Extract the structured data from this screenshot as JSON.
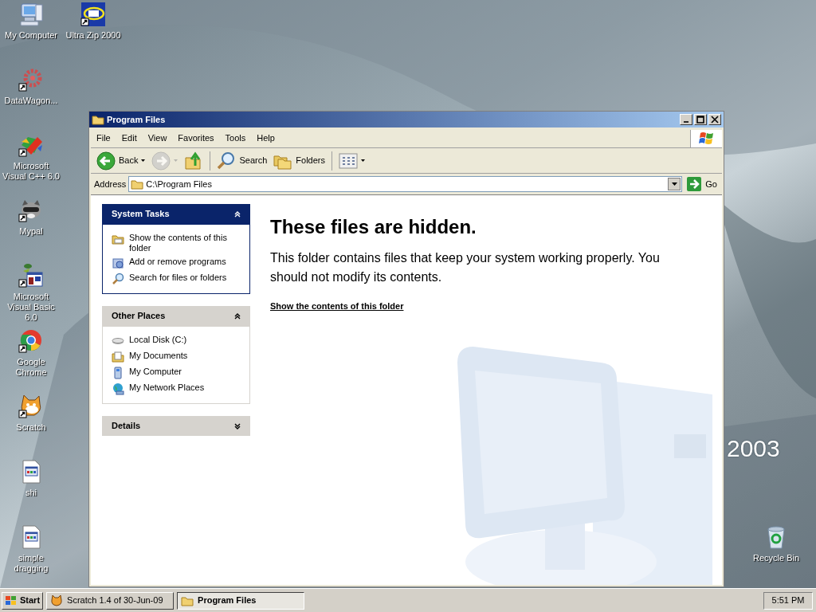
{
  "desktop": {
    "wallpaper_text": "2003",
    "icons": [
      {
        "label": "My Computer",
        "kind": "computer",
        "shortcut": false
      },
      {
        "label": "Ultra Zip 2000",
        "kind": "zip",
        "shortcut": true
      },
      {
        "label": "DataWagon...",
        "kind": "gear",
        "shortcut": true
      },
      {
        "label": "Microsoft Visual C++ 6.0",
        "kind": "cpp",
        "shortcut": true
      },
      {
        "label": "Mypal",
        "kind": "raccoon",
        "shortcut": true
      },
      {
        "label": "Microsoft Visual Basic 6.0",
        "kind": "vb",
        "shortcut": true
      },
      {
        "label": "Google Chrome",
        "kind": "chrome",
        "shortcut": true
      },
      {
        "label": "Scratch",
        "kind": "cat",
        "shortcut": true
      },
      {
        "label": "shi",
        "kind": "file",
        "shortcut": false
      },
      {
        "label": "simple dragging",
        "kind": "file",
        "shortcut": false
      },
      {
        "label": "Recycle Bin",
        "kind": "bin",
        "shortcut": false
      }
    ]
  },
  "window": {
    "title": "Program Files",
    "menu": [
      "File",
      "Edit",
      "View",
      "Favorites",
      "Tools",
      "Help"
    ],
    "toolbar": [
      {
        "kind": "back",
        "label": "Back",
        "disabled": false
      },
      {
        "kind": "forward",
        "disabled": true
      },
      {
        "kind": "up",
        "disabled": false
      },
      {
        "kind": "search",
        "label": "Search",
        "disabled": false
      },
      {
        "kind": "folders",
        "label": "Folders",
        "disabled": false
      },
      {
        "kind": "views",
        "disabled": false
      }
    ],
    "address": {
      "label": "Address",
      "value": "C:\\Program Files",
      "go": "Go"
    },
    "panels": [
      {
        "title": "System Tasks",
        "kind": "special",
        "expanded": true,
        "items": [
          {
            "label": "Show the contents of this folder",
            "kind": "folderview"
          },
          {
            "label": "Add or remove programs",
            "kind": "addremove"
          },
          {
            "label": "Search for files or folders",
            "kind": "search"
          }
        ]
      },
      {
        "title": "Other Places",
        "kind": "normal",
        "expanded": true,
        "items": [
          {
            "label": "Local Disk (C:)",
            "kind": "disk"
          },
          {
            "label": "My Documents",
            "kind": "documents"
          },
          {
            "label": "My Computer",
            "kind": "computer"
          },
          {
            "label": "My Network Places",
            "kind": "network"
          }
        ]
      },
      {
        "title": "Details",
        "kind": "normal",
        "expanded": false
      }
    ],
    "content": {
      "heading": "These files are hidden.",
      "message": "This folder contains files that keep your system working properly. You should not modify its contents.",
      "link": "Show the contents of this folder"
    }
  },
  "taskbar": {
    "start": "Start",
    "tasks": [
      {
        "label": "Scratch 1.4 of 30-Jun-09",
        "kind": "cat",
        "selected": false
      },
      {
        "label": "Program Files",
        "kind": "folder",
        "selected": true
      }
    ],
    "clock": "5:51 PM"
  }
}
